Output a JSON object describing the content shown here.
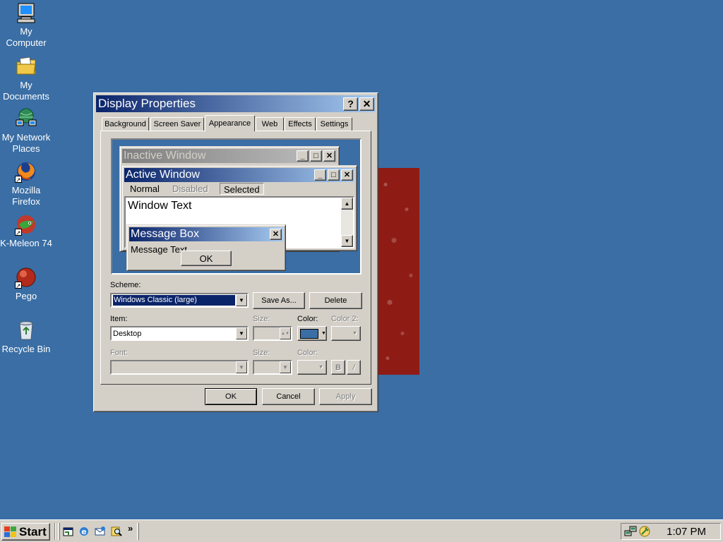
{
  "desktop": {
    "icons": [
      {
        "label": "My Computer"
      },
      {
        "label": "My Documents"
      },
      {
        "label": "My Network Places"
      },
      {
        "label": "Mozilla Firefox"
      },
      {
        "label": "K-Meleon 74"
      },
      {
        "label": "Pego"
      },
      {
        "label": "Recycle Bin"
      }
    ]
  },
  "dialog": {
    "title": "Display Properties",
    "help_glyph": "?",
    "close_glyph": "✕",
    "tabs": [
      {
        "label": "Background"
      },
      {
        "label": "Screen Saver"
      },
      {
        "label": "Appearance"
      },
      {
        "label": "Web"
      },
      {
        "label": "Effects"
      },
      {
        "label": "Settings"
      }
    ],
    "active_tab": "Appearance",
    "preview": {
      "inactive_title": "Inactive Window",
      "active_title": "Active Window",
      "menu_normal": "Normal",
      "menu_disabled": "Disabled",
      "menu_selected": "Selected",
      "window_text": "Window Text",
      "message_box_title": "Message Box",
      "message_text": "Message Text",
      "ok_label": "OK"
    },
    "scheme": {
      "label": "Scheme:",
      "value": "Windows Classic (large)",
      "save_as_label": "Save As...",
      "delete_label": "Delete"
    },
    "item": {
      "label": "Item:",
      "value": "Desktop",
      "size_label": "Size:",
      "color_label": "Color:",
      "color2_label": "Color 2:",
      "color_value": "#3a6ea5"
    },
    "font": {
      "label": "Font:",
      "size_label": "Size:",
      "color_label": "Color:",
      "bold_label": "B",
      "italic_label": "/"
    },
    "buttons": {
      "ok": "OK",
      "cancel": "Cancel",
      "apply": "Apply"
    }
  },
  "taskbar": {
    "start_label": "Start",
    "chevron": "»",
    "clock": "1:07 PM"
  },
  "colors": {
    "desktop": "#3a6ea5",
    "title_active_start": "#0a246a",
    "title_active_end": "#a6caf0",
    "title_inactive_start": "#808080",
    "title_inactive_end": "#c0c0c0",
    "face": "#d4d0c8",
    "wallpaper": "#8e1c14"
  }
}
